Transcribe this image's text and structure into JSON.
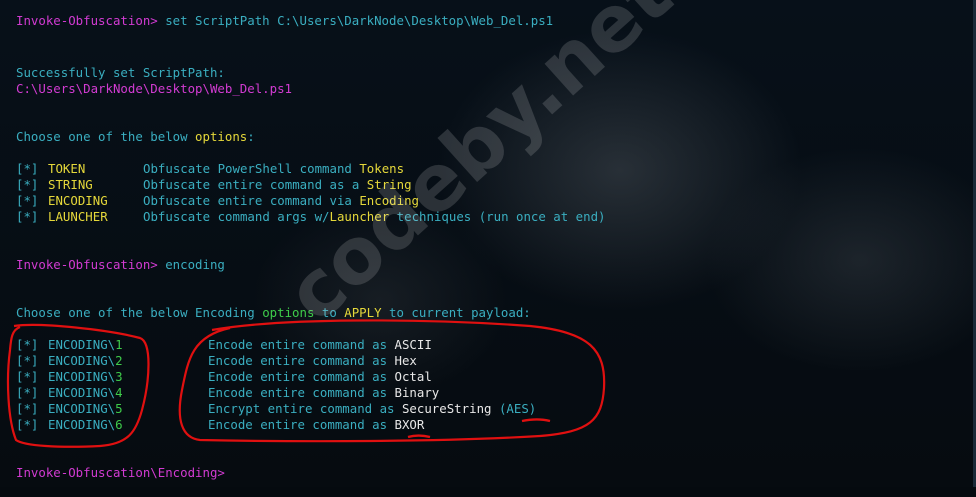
{
  "prompt": "Invoke-Obfuscation>",
  "cmd1": " set ScriptPath C:\\Users\\DarkNode\\Desktop\\Web_Del.ps1",
  "success_msg": "Successfully set ScriptPath:",
  "success_path": "C:\\Users\\DarkNode\\Desktop\\Web_Del.ps1",
  "choose1": {
    "before": "Choose one of the below ",
    "highlight": "options",
    "after": ":"
  },
  "menu1": [
    {
      "tag": "[*]",
      "name": "TOKEN",
      "desc": "Obfuscate PowerShell command ",
      "key": "Tokens",
      "tail": ""
    },
    {
      "tag": "[*]",
      "name": "STRING",
      "desc": "Obfuscate entire command as a ",
      "key": "String",
      "tail": ""
    },
    {
      "tag": "[*]",
      "name": "ENCODING",
      "desc": "Obfuscate entire command via ",
      "key": "Encoding",
      "tail": ""
    },
    {
      "tag": "[*]",
      "name": "LAUNCHER",
      "desc": "Obfuscate command args w/",
      "key": "Launcher",
      "tail": " techniques (run once at end)"
    }
  ],
  "cmd2": " encoding",
  "choose2": {
    "before": "Choose one of the below Encoding ",
    "highlight": "options",
    "mid": " to ",
    "apply": "APPLY",
    "after": " to current payload:"
  },
  "menu2": [
    {
      "tag": "[*]",
      "prefix": "ENCODING\\",
      "num": "1",
      "desc": "Encode entire command as ",
      "key": "ASCII",
      "extra": ""
    },
    {
      "tag": "[*]",
      "prefix": "ENCODING\\",
      "num": "2",
      "desc": "Encode entire command as ",
      "key": "Hex",
      "extra": ""
    },
    {
      "tag": "[*]",
      "prefix": "ENCODING\\",
      "num": "3",
      "desc": "Encode entire command as ",
      "key": "Octal",
      "extra": ""
    },
    {
      "tag": "[*]",
      "prefix": "ENCODING\\",
      "num": "4",
      "desc": "Encode entire command as ",
      "key": "Binary",
      "extra": ""
    },
    {
      "tag": "[*]",
      "prefix": "ENCODING\\",
      "num": "5",
      "desc": "Encrypt entire command as ",
      "key": "SecureString",
      "extra": " (AES)"
    },
    {
      "tag": "[*]",
      "prefix": "ENCODING\\",
      "num": "6",
      "desc": "Encode entire command as ",
      "key": "BXOR",
      "extra": ""
    }
  ],
  "final_prompt": "Invoke-Obfuscation\\Encoding>",
  "watermark": "codeby.net",
  "colors": {
    "prompt": "#d23bd2",
    "text": "#3aaec0",
    "highlight": "#e5d83a",
    "number": "#3ecc4a",
    "key": "#e8e8e8",
    "annotation": "#e01010"
  }
}
